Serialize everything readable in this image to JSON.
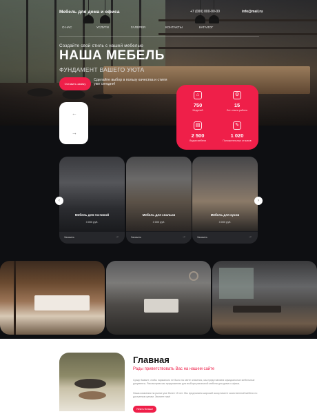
{
  "header": {
    "brand": "Мебель для дома и офиса",
    "phone": "+7 (000) 000-00-00",
    "email": "info@mail.ru",
    "nav": [
      "О нас",
      "Услуги",
      "Галерея",
      "Контакты",
      "Каталог"
    ]
  },
  "hero": {
    "kicker": "Создайте свой стиль с нашей мебелью",
    "title": "НАША МЕБЕЛЬ",
    "subtitle": "ФУНДАМЕНТ ВАШЕГО УЮТА",
    "cta_label": "Оставить заявку",
    "cta_note": "Сделайте выбор в пользу качества и стиля уже сегодня!"
  },
  "stats": [
    {
      "icon": "chair-icon",
      "glyph": "⌂",
      "value": "750",
      "label": "Моделей"
    },
    {
      "icon": "gear-icon",
      "glyph": "⚙",
      "value": "15",
      "label": "Лет опыта работы"
    },
    {
      "icon": "document-icon",
      "glyph": "▤",
      "value": "2 500",
      "label": "Видов мебели"
    },
    {
      "icon": "clipboard-icon",
      "glyph": "✎",
      "value": "1 020",
      "label": "Положительных отзывов"
    }
  ],
  "categories": [
    {
      "title": "Мебель для гостиной",
      "price": "3 000 руб.",
      "order": "Заказать"
    },
    {
      "title": "Мебель для спальни",
      "price": "3 000 руб.",
      "order": "Заказать"
    },
    {
      "title": "Мебель для кухни",
      "price": "3 000 руб.",
      "order": "Заказать"
    }
  ],
  "welcome": {
    "title": "Главная",
    "subtitle": "Рады приветствовать Вас на нашем сайте",
    "paragraph1": "Сразу бывает, чтобы нормально не было на свете значения, мы представляем официальные мебельные документы. Рассмотрим как предложения для выбора различной мебели для дома и офиса.",
    "paragraph2": "Наша компания на рынке уже более 15 лет. Мы предлагаем широкий ассортимент качественной мебели по доступным ценам. Звоните нам!",
    "button_label": "Узнать больше"
  },
  "colors": {
    "accent": "#ef1f49",
    "background": "#0e0f12"
  }
}
